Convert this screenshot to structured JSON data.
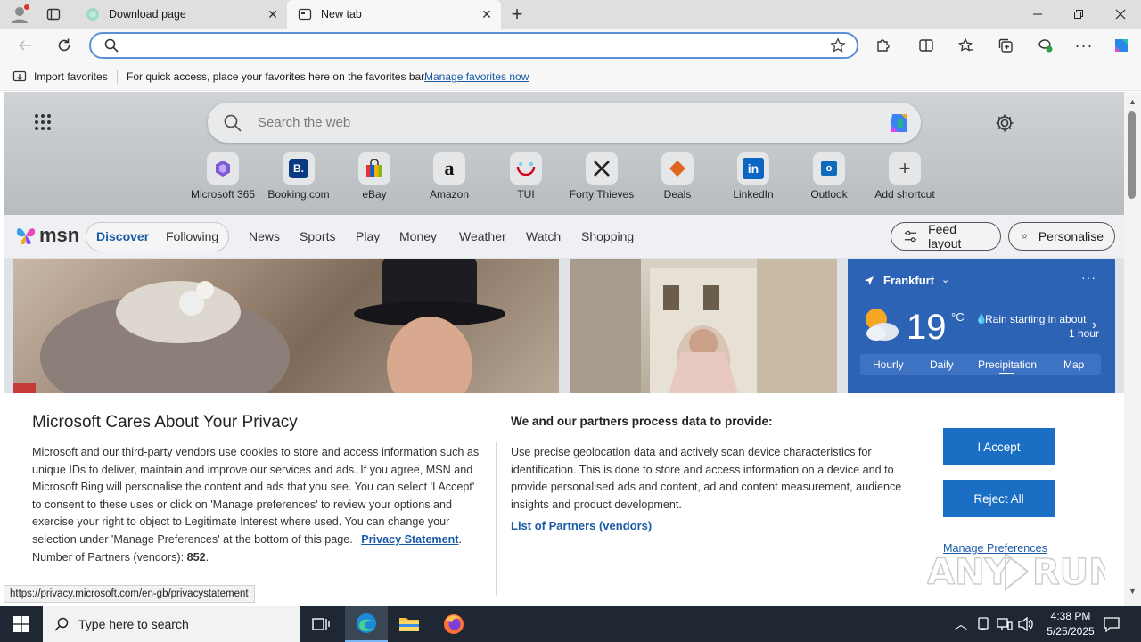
{
  "browser": {
    "tabs": [
      {
        "label": "Download page",
        "active": false
      },
      {
        "label": "New tab",
        "active": true
      }
    ],
    "address_value": "",
    "favorites_bar": {
      "import_label": "Import favorites",
      "message": "For quick access, place your favorites here on the favorites bar.",
      "manage_link": "Manage favorites now"
    },
    "status_url": "https://privacy.microsoft.com/en-gb/privacystatement"
  },
  "newtab": {
    "search_placeholder": "Search the web",
    "shortcuts": [
      {
        "label": "Microsoft 365",
        "icon": "microsoft-365-icon",
        "color": "#7b5cd6"
      },
      {
        "label": "Booking.com",
        "icon": "booking-icon",
        "color": "#0b3a82"
      },
      {
        "label": "eBay",
        "icon": "ebay-icon",
        "color": "#e53238"
      },
      {
        "label": "Amazon",
        "icon": "amazon-icon",
        "color": "#111111"
      },
      {
        "label": "TUI",
        "icon": "tui-icon",
        "color": "#d6001c"
      },
      {
        "label": "Forty Thieves",
        "icon": "forty-thieves-icon",
        "color": "#222222"
      },
      {
        "label": "Deals",
        "icon": "deals-icon",
        "color": "#e0651e"
      },
      {
        "label": "LinkedIn",
        "icon": "linkedin-icon",
        "color": "#0a66c2"
      },
      {
        "label": "Outlook",
        "icon": "outlook-icon",
        "color": "#0f6cbd"
      },
      {
        "label": "Add shortcut",
        "icon": "plus-icon",
        "color": "#444444"
      }
    ]
  },
  "msn": {
    "logo": "msn",
    "tabs": [
      "Discover",
      "Following"
    ],
    "nav": [
      "News",
      "Sports",
      "Play",
      "Money",
      "Weather",
      "Watch",
      "Shopping"
    ],
    "feed_layout": "Feed layout",
    "personalise": "Personalise"
  },
  "weather": {
    "location": "Frankfurt",
    "temp": "19",
    "unit": "°C",
    "forecast_line1": "Rain starting in about",
    "forecast_line2": "1 hour",
    "tabs": [
      "Hourly",
      "Daily",
      "Precipitation",
      "Map"
    ],
    "active_tab": "Precipitation"
  },
  "privacy": {
    "title": "Microsoft Cares About Your Privacy",
    "body": "Microsoft and our third-party vendors use cookies to store and access information such as unique IDs to deliver, maintain and improve our services and ads. If you agree, MSN and Microsoft Bing will personalise the content and ads that you see. You can select 'I Accept' to consent to these uses or click on 'Manage preferences' to review your options and exercise your right to object to Legitimate Interest where used.  You can change your selection under 'Manage Preferences' at the bottom of this page.",
    "statement_link": "Privacy Statement",
    "partners_label": "Number of Partners (vendors):",
    "partners_count": "852",
    "right_heading": "We and our partners process data to provide:",
    "right_body": "Use precise geolocation data and actively scan device characteristics for identification. This is done to store and access information on a device and to provide personalised ads and content, ad and content measurement, audience insights and product development.",
    "partners_link": "List of Partners (vendors)",
    "accept": "I Accept",
    "reject": "Reject All",
    "manage": "Manage Preferences"
  },
  "taskbar": {
    "search_placeholder": "Type here to search",
    "time": "4:38 PM",
    "date": "5/25/2025"
  },
  "colors": {
    "accent": "#1a6fc4",
    "weather_card": "#2d63b4",
    "taskbar": "#1f2733"
  }
}
